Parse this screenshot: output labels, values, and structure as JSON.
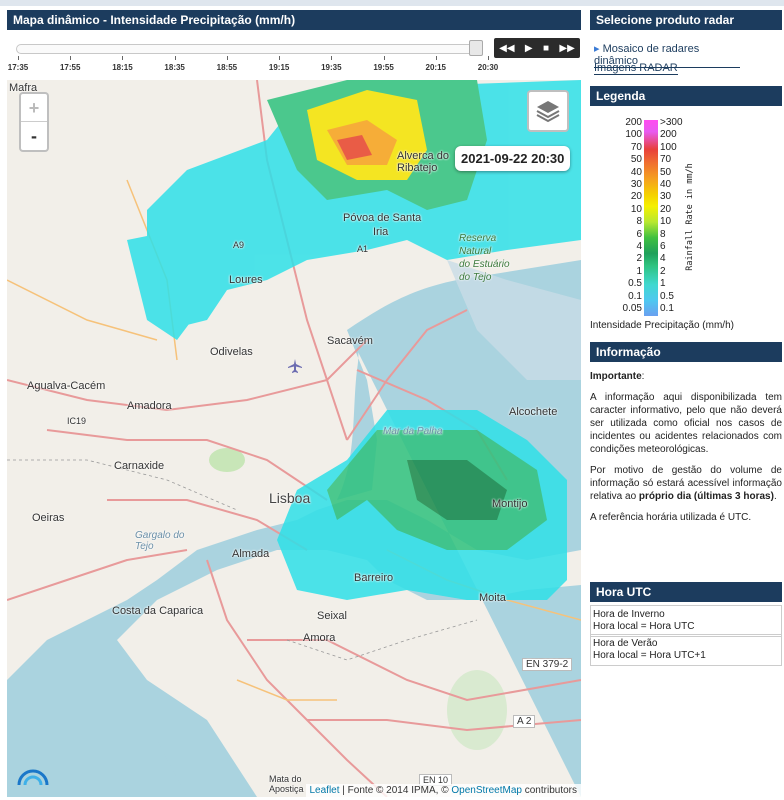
{
  "map_panel": {
    "title": "Mapa dinâmico - Intensidade Precipitação (mm/h)",
    "timeline_ticks": [
      "17:35",
      "17:55",
      "18:15",
      "18:35",
      "18:55",
      "19:15",
      "19:35",
      "19:55",
      "20:15",
      "20:30"
    ],
    "timestamp": "2021-09-22 20:30",
    "zoom_in": "+",
    "zoom_out": "-",
    "controls": [
      "rewind",
      "play",
      "stop",
      "fast-forward"
    ],
    "attribution": {
      "leaflet": "Leaflet",
      "middle": " | Fonte © 2014 IPMA, © ",
      "osm": "OpenStreetMap",
      "tail": " contributors"
    },
    "places": [
      "Mafra",
      "Loures",
      "Sacavém",
      "Odivelas",
      "Agualva-Cacém",
      "Amadora",
      "Carnaxide",
      "Lisboa",
      "Oeiras",
      "Almada",
      "Costa da Caparica",
      "Seixal",
      "Amora",
      "Barreiro",
      "Moita",
      "Montijo",
      "Alcochete",
      "Iria",
      "Póvoa de Santa",
      "Alverca do Ribatejo",
      "Mar da Palha",
      "Gargalo do Tejo",
      "Mata do Apostiça"
    ],
    "nature_reserve": [
      "Reserva",
      "Natural",
      "do Estuário",
      "do Tejo"
    ],
    "road_labels": [
      "EN 379-2",
      "A 2",
      "EN 10",
      "A1",
      "A9",
      "IC19"
    ]
  },
  "side": {
    "product_header": "Selecione produto radar",
    "product_links": [
      "Mosaico de radares dinâmico",
      "Imagens RADAR"
    ],
    "legend_header": "Legenda",
    "legend_left": [
      "200",
      "100",
      "70",
      "50",
      "40",
      "30",
      "20",
      "10",
      "8",
      "6",
      "4",
      "2",
      "1",
      "0.5",
      "0.1",
      "0.05"
    ],
    "legend_right": [
      ">300",
      "200",
      "100",
      "70",
      "50",
      "40",
      "30",
      "20",
      "10",
      "8",
      "6",
      "4",
      "2",
      "1",
      "0.5",
      "0.1"
    ],
    "legend_axis": "Rainfall Rate in mm/h",
    "legend_caption": "Intensidade Precipitação (mm/h)",
    "info_header": "Informação",
    "info_important": "Importante",
    "info_important_colon": ":",
    "info_p1": "A informação aqui disponibilizada tem caracter informativo, pelo que não deverá ser utilizada como oficial nos casos de incidentes ou acidentes relacionados com condições meteorológicas.",
    "info_p2_start": "Por motivo de gestão do volume de informação só estará acessível informação relativa ao ",
    "info_p2_bold": "próprio dia (últimas 3 horas)",
    "info_p2_end": ".",
    "info_p3": "A referência horária utilizada é UTC.",
    "utc_header": "Hora UTC",
    "winter_title": "Hora de Inverno",
    "winter_rule": "Hora local = Hora UTC",
    "summer_title": "Hora de Verão",
    "summer_rule": "Hora local = Hora UTC+1"
  },
  "colors": {
    "header": "#1c3c5e",
    "water": "#aad3df",
    "land": "#f2efe9",
    "radar_cyan": "#2fe0e8",
    "radar_green": "#1fa05a",
    "radar_yellow": "#f5e400",
    "radar_red": "#e8432a"
  }
}
